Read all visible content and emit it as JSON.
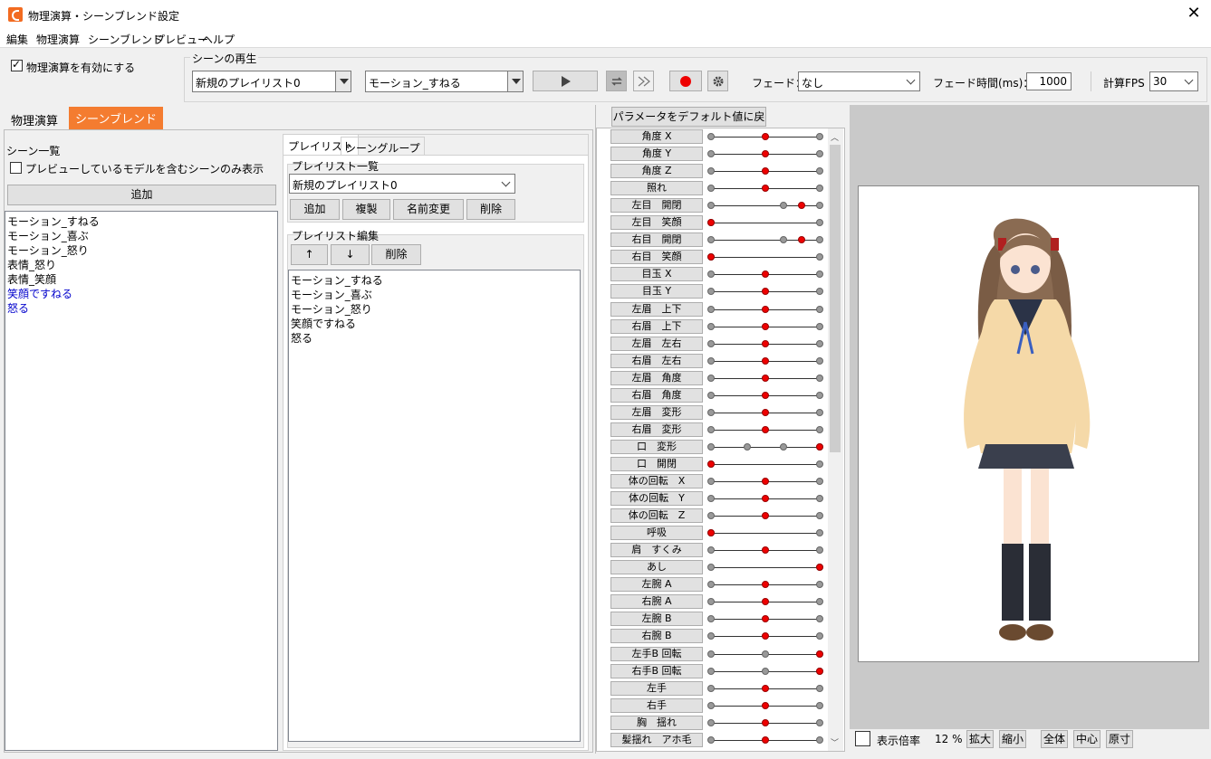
{
  "window": {
    "title": "物理演算・シーンブレンド設定",
    "close": "✕"
  },
  "menu": [
    "編集",
    "物理演算",
    "シーンブレンド",
    "プレビュー",
    "ヘルプ"
  ],
  "toolbar": {
    "physics_enable_label": "物理演算を有効にする",
    "scene_play_group": "シーンの再生",
    "playlist_combo": "新規のプレイリスト0",
    "motion_combo": "モーション_すねる",
    "fade_label": "フェード：",
    "fade_value": "なし",
    "fade_time_label": "フェード時間(ms)：",
    "fade_time_value": "1000",
    "fps_label": "計算FPS",
    "fps_value": "30"
  },
  "left_tabs": [
    "物理演算",
    "シーンブレンド"
  ],
  "scene_list": {
    "title": "シーン一覧",
    "filter_label": "プレビューしているモデルを含むシーンのみ表示",
    "add_button": "追加",
    "items": [
      {
        "label": "モーション_すねる",
        "color": "#000000"
      },
      {
        "label": "モーション_喜ぶ",
        "color": "#000000"
      },
      {
        "label": "モーション_怒り",
        "color": "#000000"
      },
      {
        "label": "表情_怒り",
        "color": "#000000"
      },
      {
        "label": "表情_笑顔",
        "color": "#000000"
      },
      {
        "label": "笑顔ですねる",
        "color": "#0000cc"
      },
      {
        "label": "怒る",
        "color": "#0000cc"
      }
    ]
  },
  "playlist_panel": {
    "tabs": [
      "プレイリスト",
      "シーングループ"
    ],
    "list_title": "プレイリスト一覧",
    "combo_value": "新規のプレイリスト0",
    "buttons": [
      "追加",
      "複製",
      "名前変更",
      "削除"
    ],
    "edit_title": "プレイリスト編集",
    "up": "↑",
    "down": "↓",
    "remove": "削除",
    "items": [
      "モーション_すねる",
      "モーション_喜ぶ",
      "モーション_怒り",
      "笑顔ですねる",
      "怒る"
    ]
  },
  "params": {
    "reset_button": "パラメータをデフォルト値に戻す",
    "items": [
      {
        "label": "角度 X",
        "pos": 0.5,
        "mids": []
      },
      {
        "label": "角度 Y",
        "pos": 0.5,
        "mids": []
      },
      {
        "label": "角度 Z",
        "pos": 0.5,
        "mids": []
      },
      {
        "label": "照れ",
        "pos": 0.5,
        "mids": []
      },
      {
        "label": "左目　開閉",
        "pos": 0.83,
        "mids": [
          0.67
        ]
      },
      {
        "label": "左目　笑顔",
        "pos": 0.0,
        "mids": []
      },
      {
        "label": "右目　開閉",
        "pos": 0.83,
        "mids": [
          0.67
        ]
      },
      {
        "label": "右目　笑顔",
        "pos": 0.0,
        "mids": []
      },
      {
        "label": "目玉 X",
        "pos": 0.5,
        "mids": []
      },
      {
        "label": "目玉 Y",
        "pos": 0.5,
        "mids": []
      },
      {
        "label": "左眉　上下",
        "pos": 0.5,
        "mids": []
      },
      {
        "label": "右眉　上下",
        "pos": 0.5,
        "mids": []
      },
      {
        "label": "左眉　左右",
        "pos": 0.5,
        "mids": []
      },
      {
        "label": "右眉　左右",
        "pos": 0.5,
        "mids": []
      },
      {
        "label": "左眉　角度",
        "pos": 0.5,
        "mids": []
      },
      {
        "label": "右眉　角度",
        "pos": 0.5,
        "mids": []
      },
      {
        "label": "左眉　変形",
        "pos": 0.5,
        "mids": []
      },
      {
        "label": "右眉　変形",
        "pos": 0.5,
        "mids": []
      },
      {
        "label": "口　変形",
        "pos": 1.0,
        "mids": [
          0.33,
          0.67
        ]
      },
      {
        "label": "口　開閉",
        "pos": 0.0,
        "mids": []
      },
      {
        "label": "体の回転　X",
        "pos": 0.5,
        "mids": []
      },
      {
        "label": "体の回転　Y",
        "pos": 0.5,
        "mids": []
      },
      {
        "label": "体の回転　Z",
        "pos": 0.5,
        "mids": []
      },
      {
        "label": "呼吸",
        "pos": 0.0,
        "mids": []
      },
      {
        "label": "肩　すくみ",
        "pos": 0.5,
        "mids": []
      },
      {
        "label": "あし",
        "pos": 1.0,
        "mids": []
      },
      {
        "label": "左腕 A",
        "pos": 0.5,
        "mids": []
      },
      {
        "label": "右腕 A",
        "pos": 0.5,
        "mids": []
      },
      {
        "label": "左腕 B",
        "pos": 0.5,
        "mids": []
      },
      {
        "label": "右腕 B",
        "pos": 0.5,
        "mids": []
      },
      {
        "label": "左手B 回転",
        "pos": 1.0,
        "mids": [
          0.5
        ]
      },
      {
        "label": "右手B 回転",
        "pos": 1.0,
        "mids": [
          0.5
        ]
      },
      {
        "label": "左手",
        "pos": 0.5,
        "mids": []
      },
      {
        "label": "右手",
        "pos": 0.5,
        "mids": []
      },
      {
        "label": "胸　揺れ",
        "pos": 0.5,
        "mids": []
      },
      {
        "label": "髪揺れ　アホ毛",
        "pos": 0.5,
        "mids": []
      }
    ]
  },
  "preview": {
    "zoom_label": "表示倍率",
    "zoom_value": "12 %",
    "buttons": [
      "拡大",
      "縮小",
      "全体",
      "中心",
      "原寸"
    ]
  }
}
